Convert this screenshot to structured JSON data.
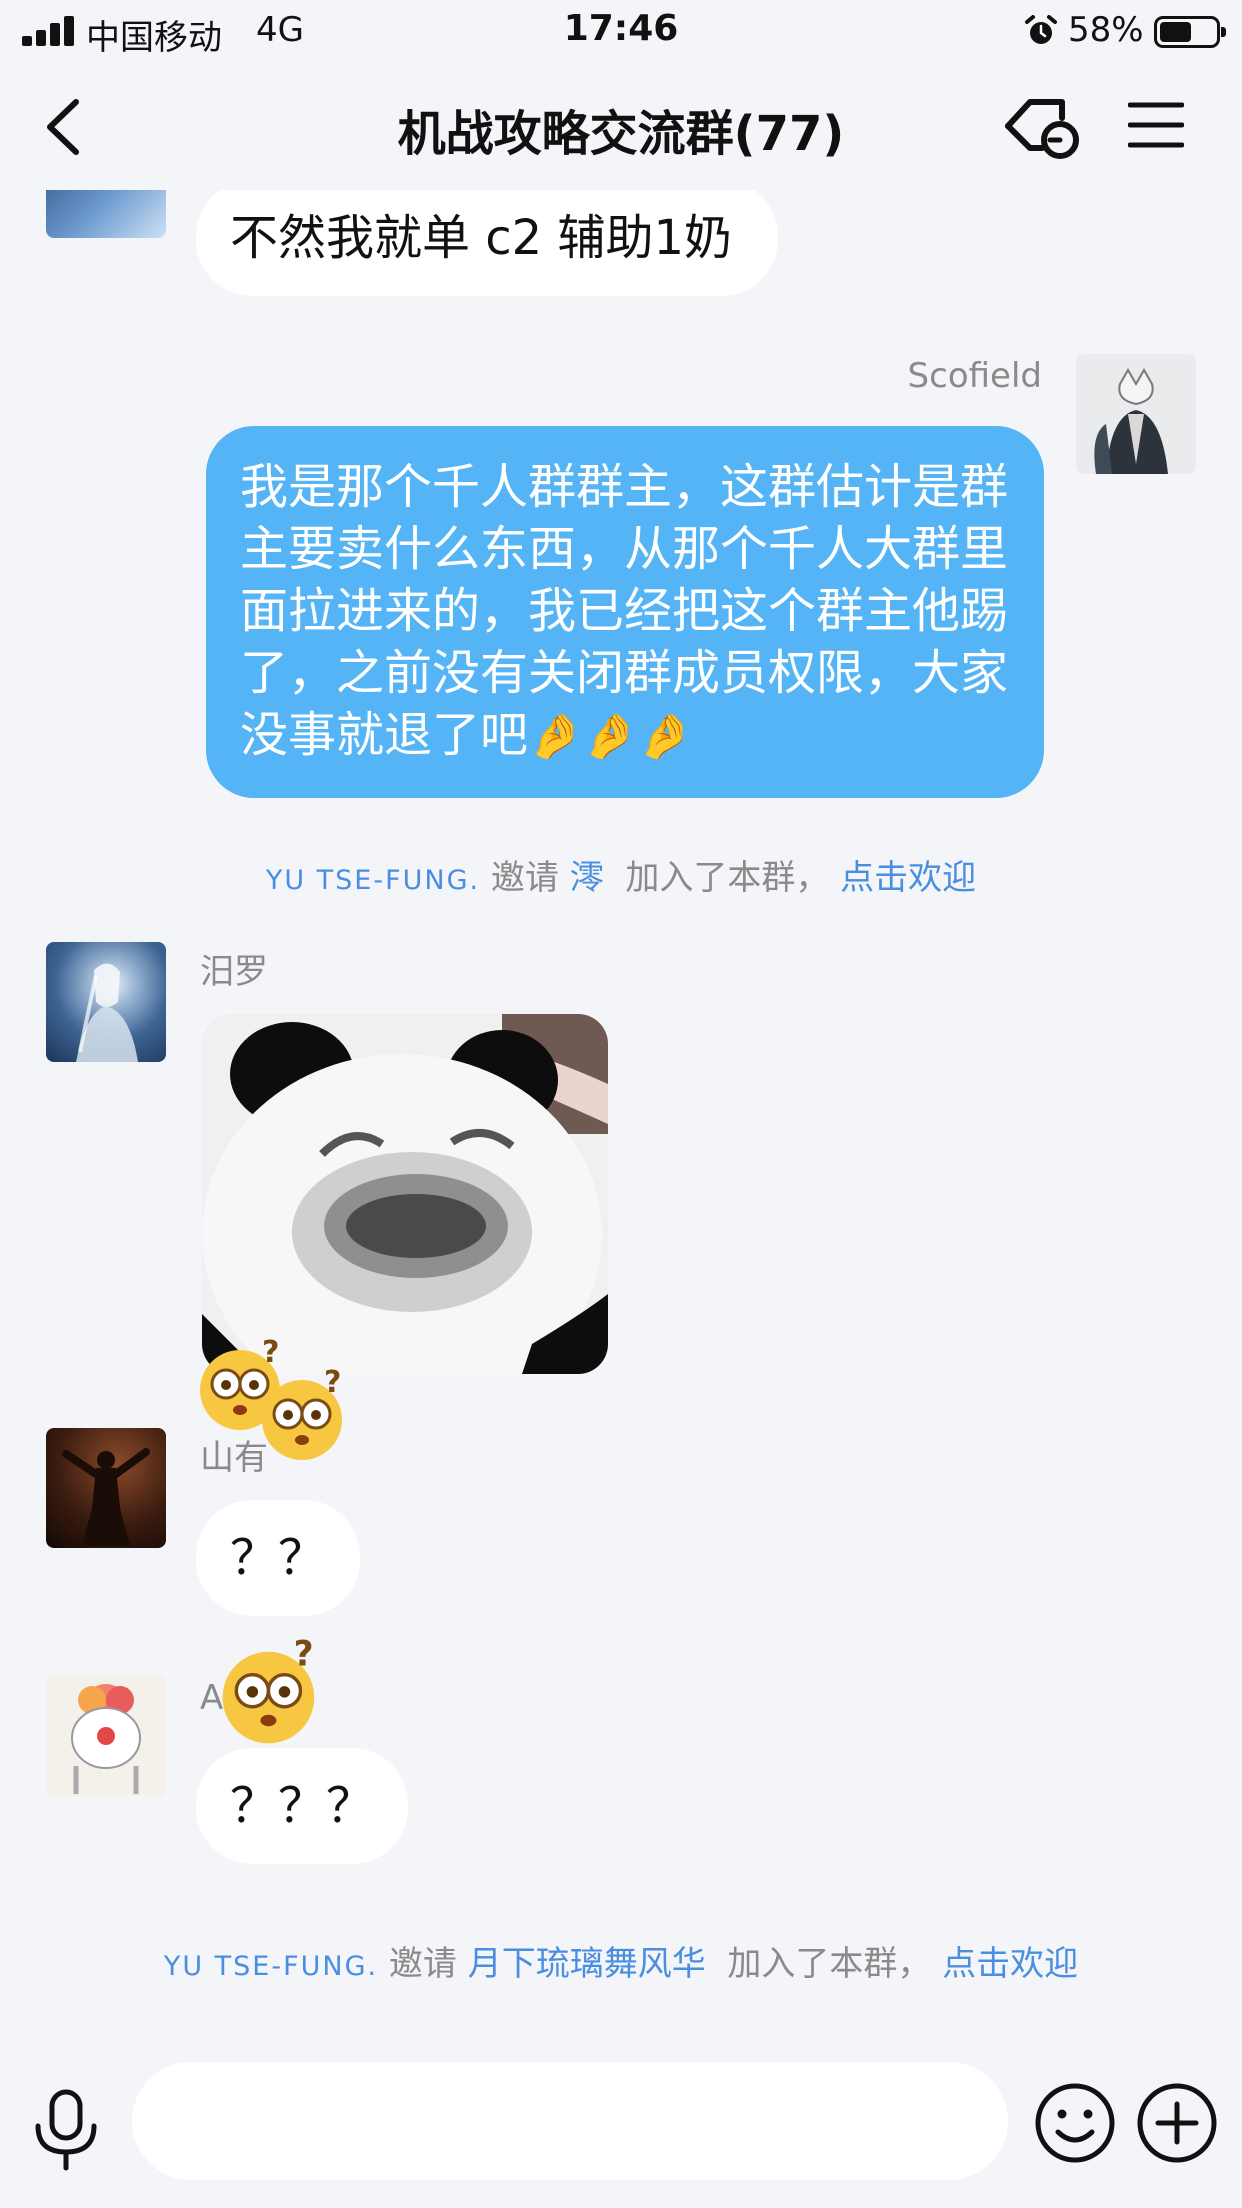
{
  "status_bar": {
    "carrier": "中国移动",
    "network": "4G",
    "time": "17:46",
    "battery_percent": "58%",
    "battery_level": 0.58
  },
  "nav": {
    "title": "机战攻略交流群(77)"
  },
  "messages": {
    "m1": {
      "text": "不然我就单 c2 辅助1奶"
    },
    "m2": {
      "sender": "Scofield",
      "text": "我是那个千人群群主，这群估计是群主要卖什么东西，从那个千人大群里面拉进来的，我已经把这个群主他踢了，之前没有关闭群成员权限，大家没事就退了吧",
      "emoji": "🤌🤌🤌"
    },
    "sys1": {
      "inviter": "YU TSE-FUNG.",
      "action": "邀请",
      "invitee": "澪",
      "joined": "加入了本群，",
      "welcome": "点击欢迎"
    },
    "m3": {
      "sender": "汨罗"
    },
    "m4": {
      "sender": "山有",
      "text": "？？"
    },
    "m5": {
      "sender": "A",
      "text": "？？？"
    },
    "sys2": {
      "inviter": "YU TSE-FUNG.",
      "action": "邀请",
      "invitee": "月下琉璃舞风华",
      "joined": "加入了本群，",
      "welcome": "点击欢迎"
    }
  },
  "input": {
    "placeholder": ""
  },
  "colors": {
    "self_bubble": "#55b4f6",
    "link_blue": "#4a8ee0",
    "background": "#f3f5f9"
  },
  "icons": [
    "signal-icon",
    "alarm-icon",
    "battery-icon",
    "back-icon",
    "link-icon",
    "menu-icon",
    "mic-icon",
    "emoji-icon",
    "plus-icon",
    "confused-face-icon"
  ]
}
